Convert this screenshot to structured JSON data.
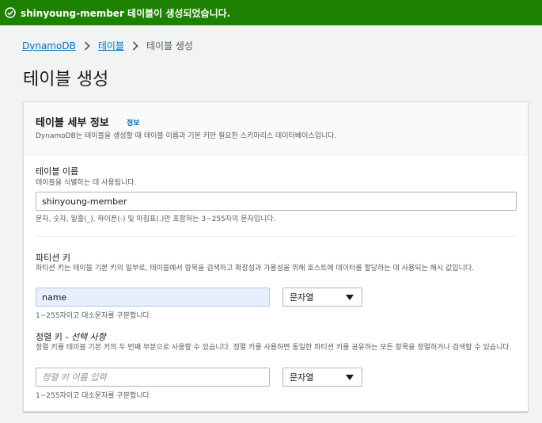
{
  "flash": {
    "message": "shinyoung-member 테이블이 생성되었습니다."
  },
  "breadcrumb": {
    "items": [
      "DynamoDB",
      "테이블",
      "테이블 생성"
    ]
  },
  "page": {
    "title": "테이블 생성"
  },
  "card": {
    "title": "테이블 세부 정보",
    "info_label": "정보",
    "description": "DynamoDB는 테이블을 생성할 때 테이블 이름과 기본 키만 필요한 스키마리스 데이터베이스입니다."
  },
  "table_name": {
    "label": "테이블 이름",
    "description": "테이블을 식별하는 데 사용됩니다.",
    "value": "shinyoung-member",
    "constraint": "문자, 숫자, 밑줄(_), 하이픈(-) 및 마침표(.)만 포함하는 3~255자의 문자입니다."
  },
  "partition_key": {
    "label": "파티션 키",
    "description": "파티션 키는 테이블 기본 키의 일부로, 테이블에서 항목을 검색하고 확장성과 가용성을 위해 호스트에 데이터를 할당하는 데 사용되는 해시 값입니다.",
    "value": "name",
    "type_selected": "문자열",
    "constraint": "1~255자이고 대소문자를 구분합니다."
  },
  "sort_key": {
    "label": "정렬 키",
    "label_optional": "- 선택 사항",
    "description": "정렬 키를 테이블 기본 키의 두 번째 부분으로 사용할 수 있습니다. 정렬 키를 사용하면 동일한 파티션 키를 공유하는 모든 항목을 정렬하거나 검색할 수 있습니다.",
    "placeholder": "정렬 키 이름 입력",
    "type_selected": "문자열",
    "constraint": "1~255자이고 대소문자를 구분합니다."
  },
  "colors": {
    "success": "#1d8102",
    "link": "#0073bb",
    "active_input": "#e6effa"
  },
  "icons": {
    "flash": "success-check-icon",
    "breadcrumb_separator": "chevron-right-icon",
    "select": "caret-down-icon"
  }
}
